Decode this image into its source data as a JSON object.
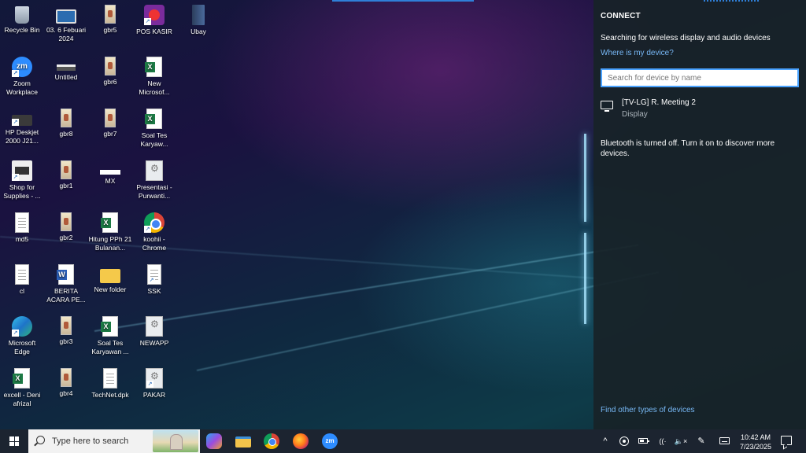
{
  "desktop": {
    "icons": [
      {
        "label": "Recycle Bin",
        "icon": "recycle-bin-icon"
      },
      {
        "label": "03. 6 Febuari 2024",
        "icon": "monitor-folder-icon"
      },
      {
        "label": "gbr5",
        "icon": "image-file-icon"
      },
      {
        "label": "POS KASIR",
        "icon": "pos-app-icon"
      },
      {
        "label": "Ubay",
        "icon": "book-file-icon"
      },
      {
        "label": "Zoom Workplace",
        "icon": "zoom-icon"
      },
      {
        "label": "Untitled",
        "icon": "paint-file-icon"
      },
      {
        "label": "gbr6",
        "icon": "image-file-icon"
      },
      {
        "label": "New Microsof...",
        "icon": "excel-file-icon"
      },
      {
        "label": "HP Deskjet 2000 J21...",
        "icon": "printer-icon"
      },
      {
        "label": "gbr8",
        "icon": "image-file-icon"
      },
      {
        "label": "gbr7",
        "icon": "image-file-icon"
      },
      {
        "label": "Soal Tes Karyaw...",
        "icon": "excel-file-icon"
      },
      {
        "label": "Shop for Supplies - ...",
        "icon": "shop-icon"
      },
      {
        "label": "gbr1",
        "icon": "image-file-icon"
      },
      {
        "label": "MX",
        "icon": "mx-file-icon"
      },
      {
        "label": "Presentasi - Purwanti...",
        "icon": "presentation-icon"
      },
      {
        "label": "md5",
        "icon": "text-file-icon"
      },
      {
        "label": "gbr2",
        "icon": "image-file-icon"
      },
      {
        "label": "Hitung PPh 21 Bulanan...",
        "icon": "excel-file-icon"
      },
      {
        "label": "koohii - Chrome",
        "icon": "chrome-icon"
      },
      {
        "label": "cl",
        "icon": "text-file-icon"
      },
      {
        "label": "BERITA ACARA PE...",
        "icon": "word-file-icon"
      },
      {
        "label": "New folder",
        "icon": "folder-icon"
      },
      {
        "label": "SSK",
        "icon": "shortcut-file-icon"
      },
      {
        "label": "Microsoft Edge",
        "icon": "edge-icon"
      },
      {
        "label": "gbr3",
        "icon": "image-file-icon"
      },
      {
        "label": "Soal Tes Karyawan ...",
        "icon": "excel-file-icon"
      },
      {
        "label": "NEWAPP",
        "icon": "app-settings-icon"
      },
      {
        "label": "excell - Deni afrizal",
        "icon": "excel-file-icon"
      },
      {
        "label": "gbr4",
        "icon": "image-file-icon"
      },
      {
        "label": "TechNet.dpk",
        "icon": "text-file-icon"
      },
      {
        "label": "PAKAR",
        "icon": "app-settings-icon"
      }
    ]
  },
  "connect_panel": {
    "title": "CONNECT",
    "status": "Searching for wireless display and audio devices",
    "where_link": "Where is my device?",
    "search_placeholder": "Search for device by name",
    "search_value": "",
    "devices": [
      {
        "name": "[TV-LG] R. Meeting 2",
        "type": "Display",
        "icon": "display-icon"
      }
    ],
    "bluetooth_note": "Bluetooth is turned off. Turn it on to discover more devices.",
    "other_link": "Find other types of devices"
  },
  "taskbar": {
    "search_text": "Type here to search",
    "apps": [
      {
        "name": "Copilot",
        "icon": "copilot-icon"
      },
      {
        "name": "File Explorer",
        "icon": "file-explorer-icon"
      },
      {
        "name": "Google Chrome",
        "icon": "chrome-icon"
      },
      {
        "name": "Firefox",
        "icon": "firefox-icon"
      },
      {
        "name": "Zoom",
        "icon": "zoom-icon",
        "glyph": "zm"
      }
    ],
    "tray": {
      "chevron": "^",
      "wifi": "((·",
      "mute": "🔈×",
      "pen": "✎",
      "time": "10:42 AM",
      "date": "7/23/2025"
    }
  }
}
